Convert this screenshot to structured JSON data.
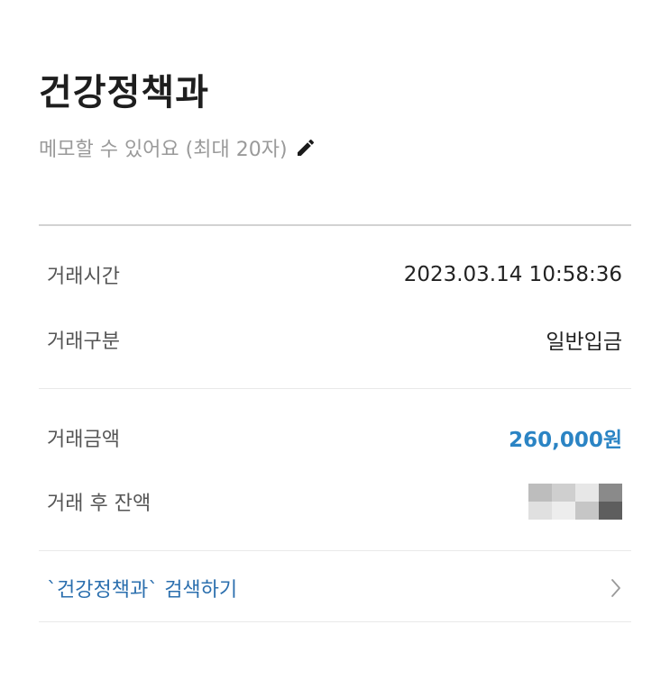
{
  "header": {
    "title": "건강정책과",
    "memo_placeholder": "메모할 수 있어요 (최대 20자)",
    "edit_icon": "pencil-icon"
  },
  "details": [
    {
      "label": "거래시간",
      "value": "2023.03.14 10:58:36"
    },
    {
      "label": "거래구분",
      "value": "일반입금"
    }
  ],
  "amount": {
    "label": "거래금액",
    "value": "260,000원",
    "color": "#2b84c4"
  },
  "balance": {
    "label": "거래 후 잔액",
    "value_censored": true
  },
  "search_link": {
    "label": "`건강정책과` 검색하기",
    "icon": "chevron-right-icon"
  },
  "colors": {
    "accent": "#2b84c4",
    "link": "#2b6fae",
    "muted_text": "#9a9a9a"
  }
}
